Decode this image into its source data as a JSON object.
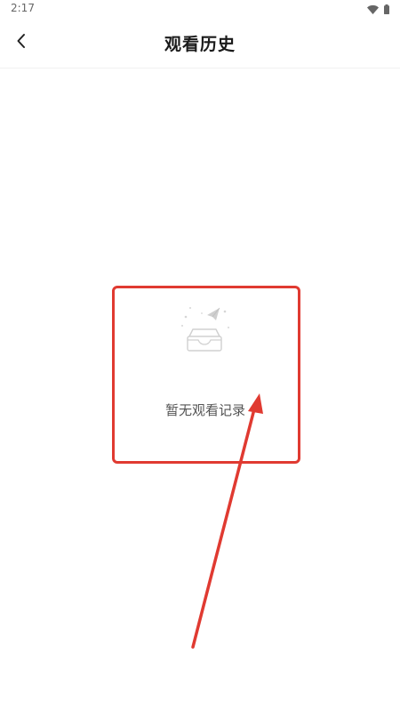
{
  "status_bar": {
    "time": "2:17",
    "icons": [
      "wifi-icon",
      "battery-icon"
    ]
  },
  "nav": {
    "back_icon": "chevron-left-icon",
    "title": "观看历史"
  },
  "empty_state": {
    "icon": "empty-tray-icon",
    "message": "暂无观看记录"
  },
  "annotation": {
    "color": "#e03a31"
  }
}
